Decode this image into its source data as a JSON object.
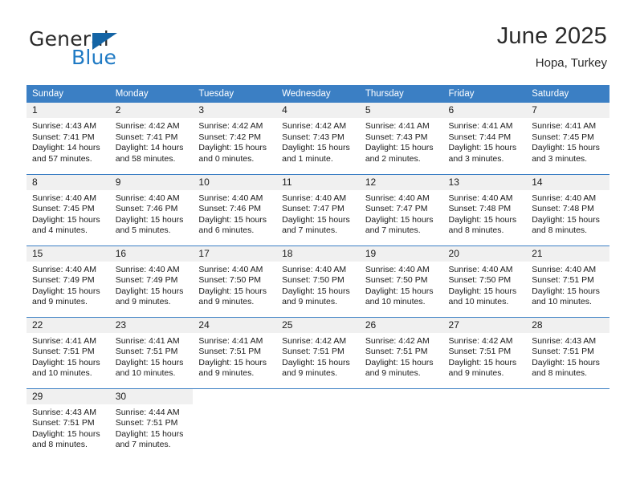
{
  "brand": {
    "word_one": "General",
    "word_two": "Blue",
    "logo_icon": "triangle-flag-icon"
  },
  "header": {
    "title": "June 2025",
    "subtitle": "Hopa, Turkey"
  },
  "colors": {
    "header_blue": "#3b7fc4",
    "brand_blue": "#1f7ac4",
    "logo_blue": "#1464a5",
    "daynum_band": "#f0f0f0",
    "text": "#1a1a1a"
  },
  "calendar": {
    "weekday_headers": [
      "Sunday",
      "Monday",
      "Tuesday",
      "Wednesday",
      "Thursday",
      "Friday",
      "Saturday"
    ],
    "weeks": [
      [
        {
          "day": "1",
          "sunrise": "Sunrise: 4:43 AM",
          "sunset": "Sunset: 7:41 PM",
          "daylight_line1": "Daylight: 14 hours",
          "daylight_line2": "and 57 minutes."
        },
        {
          "day": "2",
          "sunrise": "Sunrise: 4:42 AM",
          "sunset": "Sunset: 7:41 PM",
          "daylight_line1": "Daylight: 14 hours",
          "daylight_line2": "and 58 minutes."
        },
        {
          "day": "3",
          "sunrise": "Sunrise: 4:42 AM",
          "sunset": "Sunset: 7:42 PM",
          "daylight_line1": "Daylight: 15 hours",
          "daylight_line2": "and 0 minutes."
        },
        {
          "day": "4",
          "sunrise": "Sunrise: 4:42 AM",
          "sunset": "Sunset: 7:43 PM",
          "daylight_line1": "Daylight: 15 hours",
          "daylight_line2": "and 1 minute."
        },
        {
          "day": "5",
          "sunrise": "Sunrise: 4:41 AM",
          "sunset": "Sunset: 7:43 PM",
          "daylight_line1": "Daylight: 15 hours",
          "daylight_line2": "and 2 minutes."
        },
        {
          "day": "6",
          "sunrise": "Sunrise: 4:41 AM",
          "sunset": "Sunset: 7:44 PM",
          "daylight_line1": "Daylight: 15 hours",
          "daylight_line2": "and 3 minutes."
        },
        {
          "day": "7",
          "sunrise": "Sunrise: 4:41 AM",
          "sunset": "Sunset: 7:45 PM",
          "daylight_line1": "Daylight: 15 hours",
          "daylight_line2": "and 3 minutes."
        }
      ],
      [
        {
          "day": "8",
          "sunrise": "Sunrise: 4:40 AM",
          "sunset": "Sunset: 7:45 PM",
          "daylight_line1": "Daylight: 15 hours",
          "daylight_line2": "and 4 minutes."
        },
        {
          "day": "9",
          "sunrise": "Sunrise: 4:40 AM",
          "sunset": "Sunset: 7:46 PM",
          "daylight_line1": "Daylight: 15 hours",
          "daylight_line2": "and 5 minutes."
        },
        {
          "day": "10",
          "sunrise": "Sunrise: 4:40 AM",
          "sunset": "Sunset: 7:46 PM",
          "daylight_line1": "Daylight: 15 hours",
          "daylight_line2": "and 6 minutes."
        },
        {
          "day": "11",
          "sunrise": "Sunrise: 4:40 AM",
          "sunset": "Sunset: 7:47 PM",
          "daylight_line1": "Daylight: 15 hours",
          "daylight_line2": "and 7 minutes."
        },
        {
          "day": "12",
          "sunrise": "Sunrise: 4:40 AM",
          "sunset": "Sunset: 7:47 PM",
          "daylight_line1": "Daylight: 15 hours",
          "daylight_line2": "and 7 minutes."
        },
        {
          "day": "13",
          "sunrise": "Sunrise: 4:40 AM",
          "sunset": "Sunset: 7:48 PM",
          "daylight_line1": "Daylight: 15 hours",
          "daylight_line2": "and 8 minutes."
        },
        {
          "day": "14",
          "sunrise": "Sunrise: 4:40 AM",
          "sunset": "Sunset: 7:48 PM",
          "daylight_line1": "Daylight: 15 hours",
          "daylight_line2": "and 8 minutes."
        }
      ],
      [
        {
          "day": "15",
          "sunrise": "Sunrise: 4:40 AM",
          "sunset": "Sunset: 7:49 PM",
          "daylight_line1": "Daylight: 15 hours",
          "daylight_line2": "and 9 minutes."
        },
        {
          "day": "16",
          "sunrise": "Sunrise: 4:40 AM",
          "sunset": "Sunset: 7:49 PM",
          "daylight_line1": "Daylight: 15 hours",
          "daylight_line2": "and 9 minutes."
        },
        {
          "day": "17",
          "sunrise": "Sunrise: 4:40 AM",
          "sunset": "Sunset: 7:50 PM",
          "daylight_line1": "Daylight: 15 hours",
          "daylight_line2": "and 9 minutes."
        },
        {
          "day": "18",
          "sunrise": "Sunrise: 4:40 AM",
          "sunset": "Sunset: 7:50 PM",
          "daylight_line1": "Daylight: 15 hours",
          "daylight_line2": "and 9 minutes."
        },
        {
          "day": "19",
          "sunrise": "Sunrise: 4:40 AM",
          "sunset": "Sunset: 7:50 PM",
          "daylight_line1": "Daylight: 15 hours",
          "daylight_line2": "and 10 minutes."
        },
        {
          "day": "20",
          "sunrise": "Sunrise: 4:40 AM",
          "sunset": "Sunset: 7:50 PM",
          "daylight_line1": "Daylight: 15 hours",
          "daylight_line2": "and 10 minutes."
        },
        {
          "day": "21",
          "sunrise": "Sunrise: 4:40 AM",
          "sunset": "Sunset: 7:51 PM",
          "daylight_line1": "Daylight: 15 hours",
          "daylight_line2": "and 10 minutes."
        }
      ],
      [
        {
          "day": "22",
          "sunrise": "Sunrise: 4:41 AM",
          "sunset": "Sunset: 7:51 PM",
          "daylight_line1": "Daylight: 15 hours",
          "daylight_line2": "and 10 minutes."
        },
        {
          "day": "23",
          "sunrise": "Sunrise: 4:41 AM",
          "sunset": "Sunset: 7:51 PM",
          "daylight_line1": "Daylight: 15 hours",
          "daylight_line2": "and 10 minutes."
        },
        {
          "day": "24",
          "sunrise": "Sunrise: 4:41 AM",
          "sunset": "Sunset: 7:51 PM",
          "daylight_line1": "Daylight: 15 hours",
          "daylight_line2": "and 9 minutes."
        },
        {
          "day": "25",
          "sunrise": "Sunrise: 4:42 AM",
          "sunset": "Sunset: 7:51 PM",
          "daylight_line1": "Daylight: 15 hours",
          "daylight_line2": "and 9 minutes."
        },
        {
          "day": "26",
          "sunrise": "Sunrise: 4:42 AM",
          "sunset": "Sunset: 7:51 PM",
          "daylight_line1": "Daylight: 15 hours",
          "daylight_line2": "and 9 minutes."
        },
        {
          "day": "27",
          "sunrise": "Sunrise: 4:42 AM",
          "sunset": "Sunset: 7:51 PM",
          "daylight_line1": "Daylight: 15 hours",
          "daylight_line2": "and 9 minutes."
        },
        {
          "day": "28",
          "sunrise": "Sunrise: 4:43 AM",
          "sunset": "Sunset: 7:51 PM",
          "daylight_line1": "Daylight: 15 hours",
          "daylight_line2": "and 8 minutes."
        }
      ],
      [
        {
          "day": "29",
          "sunrise": "Sunrise: 4:43 AM",
          "sunset": "Sunset: 7:51 PM",
          "daylight_line1": "Daylight: 15 hours",
          "daylight_line2": "and 8 minutes."
        },
        {
          "day": "30",
          "sunrise": "Sunrise: 4:44 AM",
          "sunset": "Sunset: 7:51 PM",
          "daylight_line1": "Daylight: 15 hours",
          "daylight_line2": "and 7 minutes."
        },
        {
          "day": "",
          "sunrise": "",
          "sunset": "",
          "daylight_line1": "",
          "daylight_line2": ""
        },
        {
          "day": "",
          "sunrise": "",
          "sunset": "",
          "daylight_line1": "",
          "daylight_line2": ""
        },
        {
          "day": "",
          "sunrise": "",
          "sunset": "",
          "daylight_line1": "",
          "daylight_line2": ""
        },
        {
          "day": "",
          "sunrise": "",
          "sunset": "",
          "daylight_line1": "",
          "daylight_line2": ""
        },
        {
          "day": "",
          "sunrise": "",
          "sunset": "",
          "daylight_line1": "",
          "daylight_line2": ""
        }
      ]
    ]
  }
}
